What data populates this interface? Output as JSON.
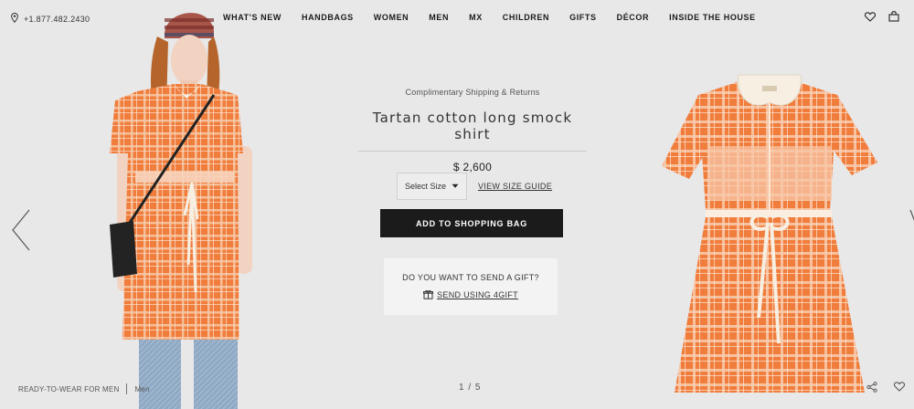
{
  "header": {
    "phone": "+1.877.482.2430",
    "nav": [
      "WHAT'S NEW",
      "HANDBAGS",
      "WOMEN",
      "MEN",
      "MX",
      "CHILDREN",
      "GIFTS",
      "DÉCOR",
      "INSIDE THE HOUSE"
    ],
    "icons": [
      "location-pin-icon",
      "heart-icon",
      "shopping-bag-icon"
    ]
  },
  "product": {
    "shipping_note": "Complimentary Shipping & Returns",
    "title": "Tartan cotton long smock shirt",
    "price": "$ 2,600",
    "size_select": "Select Size",
    "size_guide": "VIEW SIZE GUIDE",
    "add_to_bag": "ADD TO SHOPPING BAG"
  },
  "gift": {
    "question": "DO YOU WANT TO SEND A GIFT?",
    "link": "SEND USING 4GIFT"
  },
  "footer": {
    "category": "READY-TO-WEAR FOR MEN",
    "subcategory": "Men",
    "pager": "1 / 5"
  },
  "colors": {
    "background": "#e8e8e8",
    "primary_button": "#1b1b1b",
    "dress_orange": "#f07d3c",
    "collar": "#f6efe2"
  }
}
